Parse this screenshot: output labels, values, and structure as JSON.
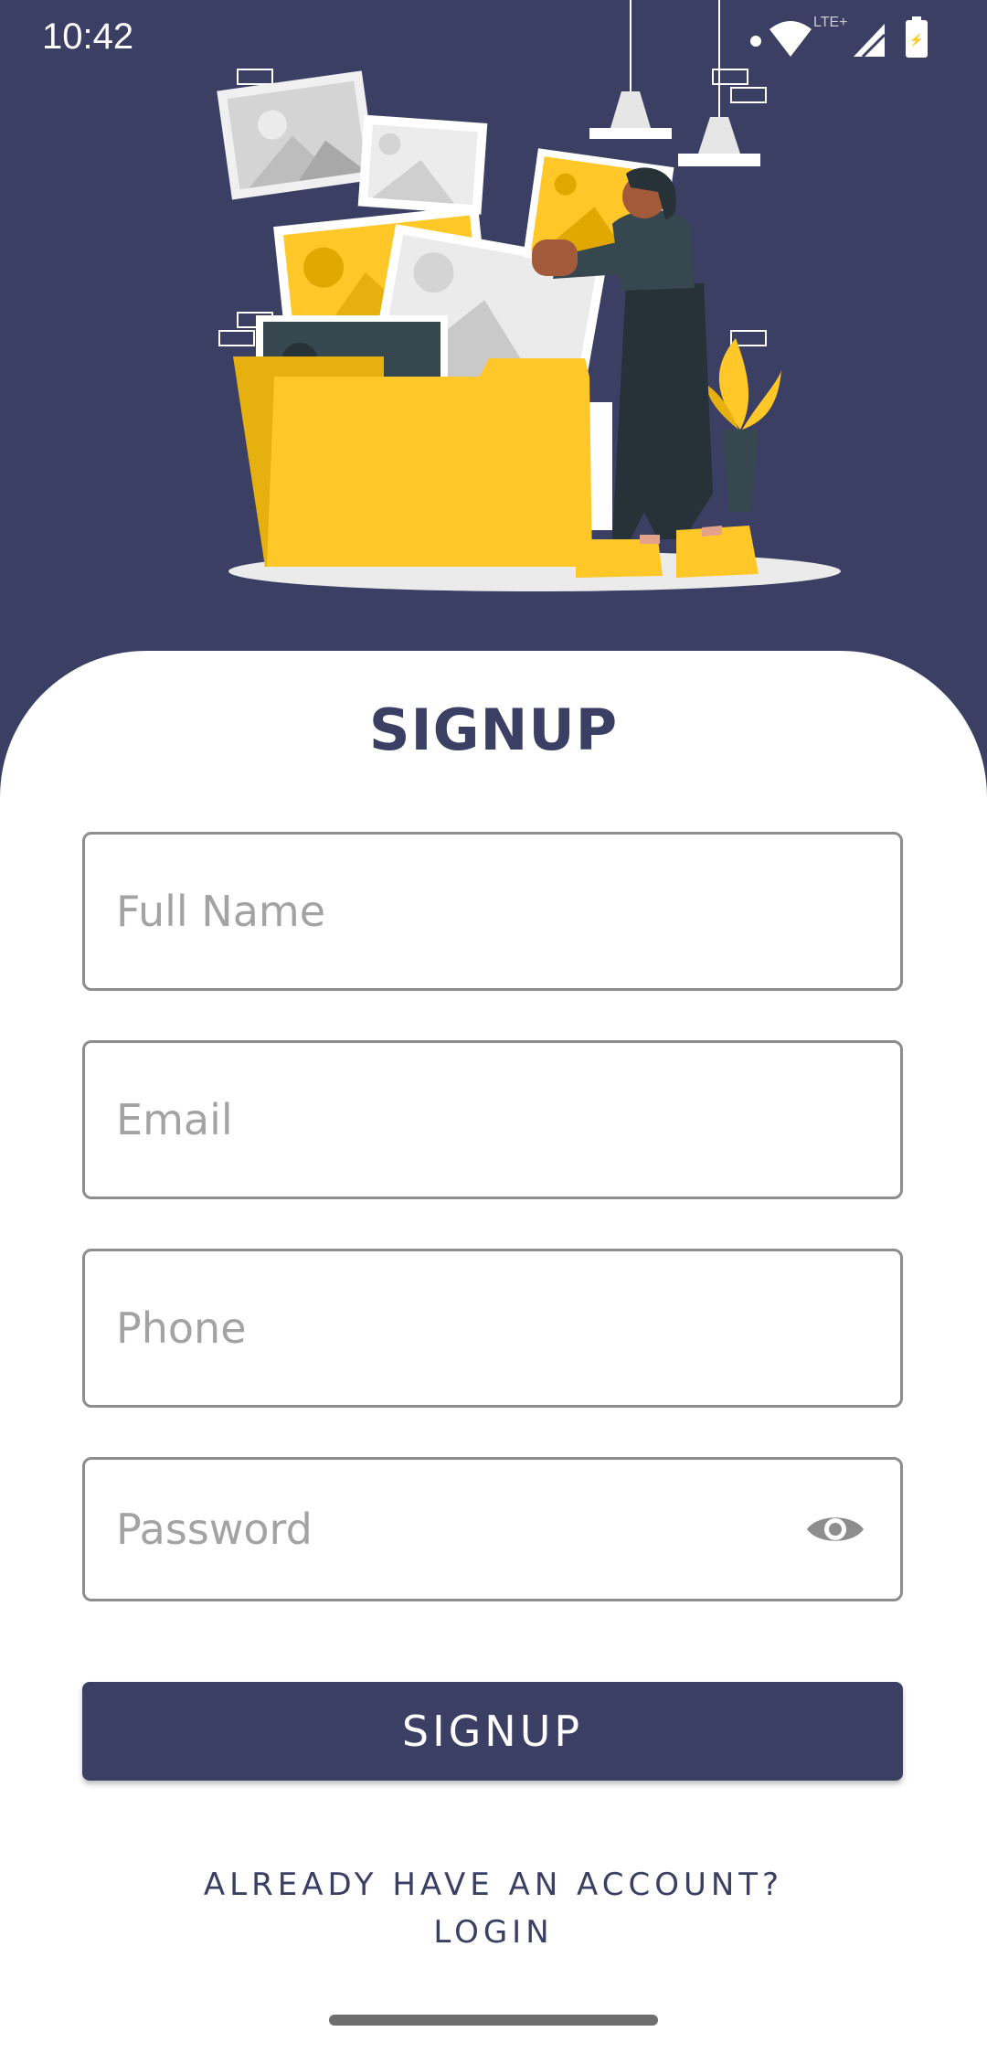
{
  "status_bar": {
    "time": "10:42",
    "network": "LTE+",
    "icons": [
      "notification-dot-icon",
      "wifi-icon",
      "signal-icon",
      "battery-icon"
    ]
  },
  "illustration": {
    "description_icon": "folder-photos-illustration",
    "accent_color": "#ffc727",
    "dark_color": "#263238"
  },
  "form": {
    "title": "SIGNUP",
    "fields": [
      {
        "name": "full-name",
        "placeholder": "Full Name"
      },
      {
        "name": "email",
        "placeholder": "Email"
      },
      {
        "name": "phone",
        "placeholder": "Phone"
      },
      {
        "name": "password",
        "placeholder": "Password",
        "icon": "eye-icon"
      }
    ],
    "submit_label": "SIGNUP",
    "login_prompt_line1": "ALREADY HAVE AN ACCOUNT?",
    "login_prompt_line2": "LOGIN"
  },
  "colors": {
    "primary": "#3a3f63",
    "background": "#ffffff",
    "placeholder": "#a3a3a3",
    "border": "#8d8d8d"
  }
}
